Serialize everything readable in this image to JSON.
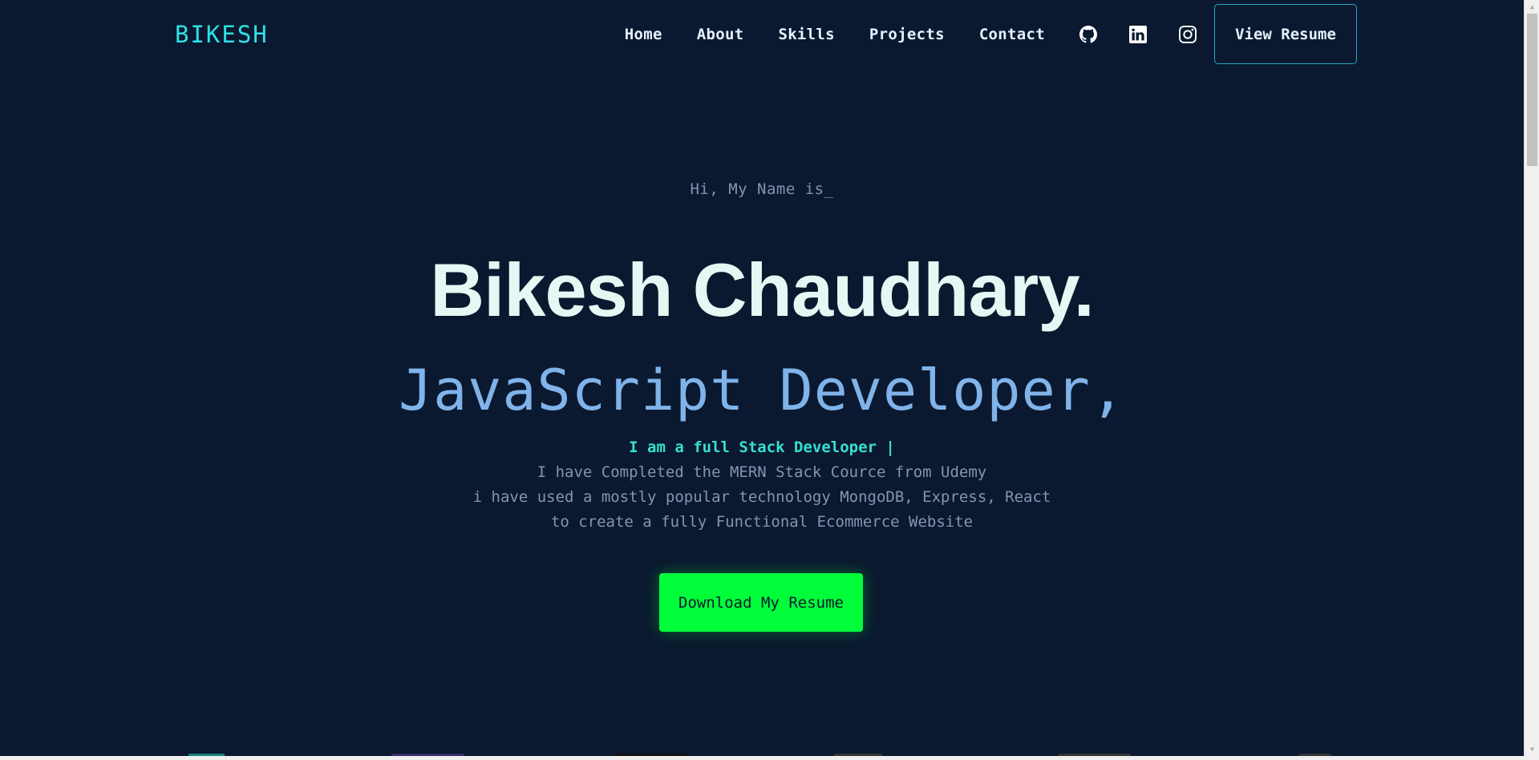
{
  "nav": {
    "logo": "BIKESH",
    "links": [
      "Home",
      "About",
      "Skills",
      "Projects",
      "Contact"
    ],
    "icons": [
      "github-icon",
      "linkedin-icon",
      "instagram-icon"
    ],
    "resume_button": "View Resume"
  },
  "hero": {
    "greeting": "Hi, My Name is_",
    "name": "Bikesh Chaudhary.",
    "role": "JavaScript Developer,",
    "tagline": "I am a full Stack Developer |",
    "lines": [
      "I have Completed the MERN Stack Cource from Udemy",
      "i have used a mostly popular technology MongoDB, Express, React",
      "to create a fully Functional Ecommerce Website"
    ],
    "cta": "Download My Resume"
  },
  "colors": {
    "background": "#0a192f",
    "accent": "#2de2e6",
    "cta": "#00ff3a",
    "role": "#7fb3ea"
  }
}
